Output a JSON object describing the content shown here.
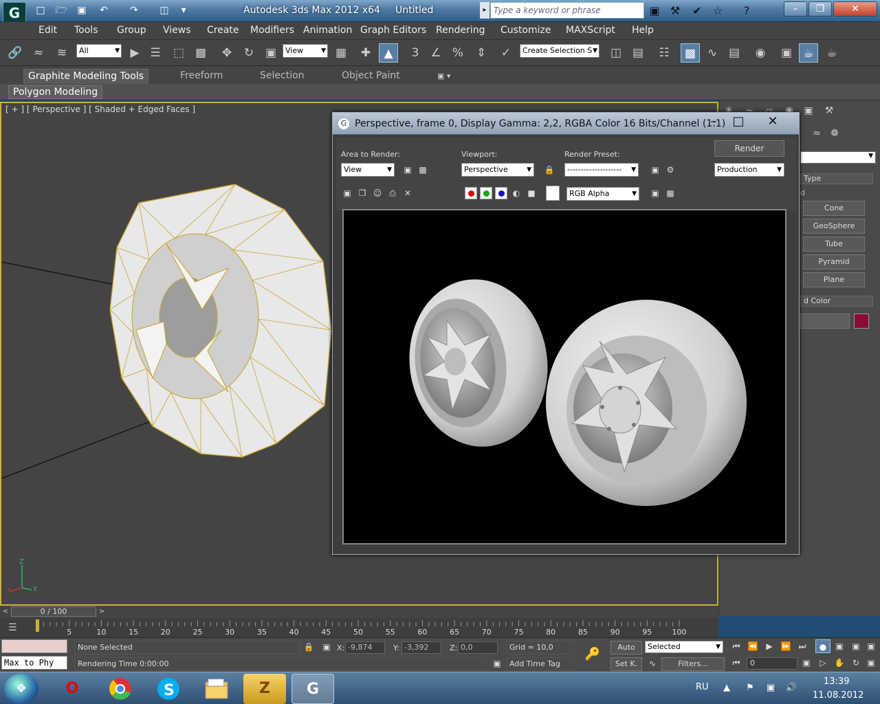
{
  "titlebar": {
    "app_name": "Autodesk 3ds Max  2012 x64",
    "document": "Untitled",
    "search_placeholder": "Type a keyword or phrase",
    "logo_letter": "G"
  },
  "menu": [
    "Edit",
    "Tools",
    "Group",
    "Views",
    "Create",
    "Modifiers",
    "Animation",
    "Graph Editors",
    "Rendering",
    "Customize",
    "MAXScript",
    "Help"
  ],
  "toolbar": {
    "selection_filter": "All",
    "ref_coord": "View",
    "snap_3": "3",
    "snap_pct": "%",
    "named_selection": "Create Selection S"
  },
  "ribbon": {
    "tabs": [
      "Graphite Modeling Tools",
      "Freeform",
      "Selection",
      "Object Paint"
    ],
    "active_tab": 0,
    "panel_label": "Polygon Modeling"
  },
  "viewport": {
    "label": "[ + ] [ Perspective ] [ Shaded + Edged Faces ]",
    "axis_x": "X",
    "axis_y": "Y",
    "axis_z": "Z",
    "wire_color": "#c9a227"
  },
  "command_panel": {
    "rollout_type": "Type",
    "partial_text": "d",
    "buttons": [
      "Cone",
      "GeoSphere",
      "Tube",
      "Pyramid",
      "Plane"
    ],
    "rollout_color": "d Color",
    "object_color": "#8a0b3a"
  },
  "render_window": {
    "title": "Perspective, frame 0, Display Gamma: 2,2, RGBA Color 16 Bits/Channel (1:1)",
    "area_label": "Area to Render:",
    "area_value": "View",
    "viewport_label": "Viewport:",
    "viewport_value": "Perspective",
    "preset_label": "Render Preset:",
    "preset_value": "--------------------",
    "render_button": "Render",
    "production_value": "Production",
    "channel_value": "RGB Alpha"
  },
  "timeline": {
    "position": "0 / 100",
    "ticks": [
      "5",
      "10",
      "15",
      "20",
      "25",
      "30",
      "35",
      "40",
      "45",
      "50",
      "55",
      "60",
      "65",
      "70",
      "75",
      "80",
      "85",
      "90",
      "95",
      "100"
    ]
  },
  "status": {
    "listener_text": "Max to Phy",
    "selection": "None Selected",
    "render_time": "Rendering Time  0:00:00",
    "x_label": "X:",
    "x_value": "-9,874",
    "y_label": "Y:",
    "y_value": "-3,392",
    "z_label": "Z:",
    "z_value": "0,0",
    "grid": "Grid = 10,0",
    "add_time_tag": "Add Time Tag",
    "auto_key": "Auto",
    "set_key": "Set K.",
    "key_filter": "Selected",
    "filters": "Filters...",
    "frame": "0"
  },
  "taskbar": {
    "language": "RU",
    "time": "13:39",
    "date": "11.08.2012",
    "opera_letter": "O",
    "zip_letter": "Z",
    "max_letter": "G"
  }
}
